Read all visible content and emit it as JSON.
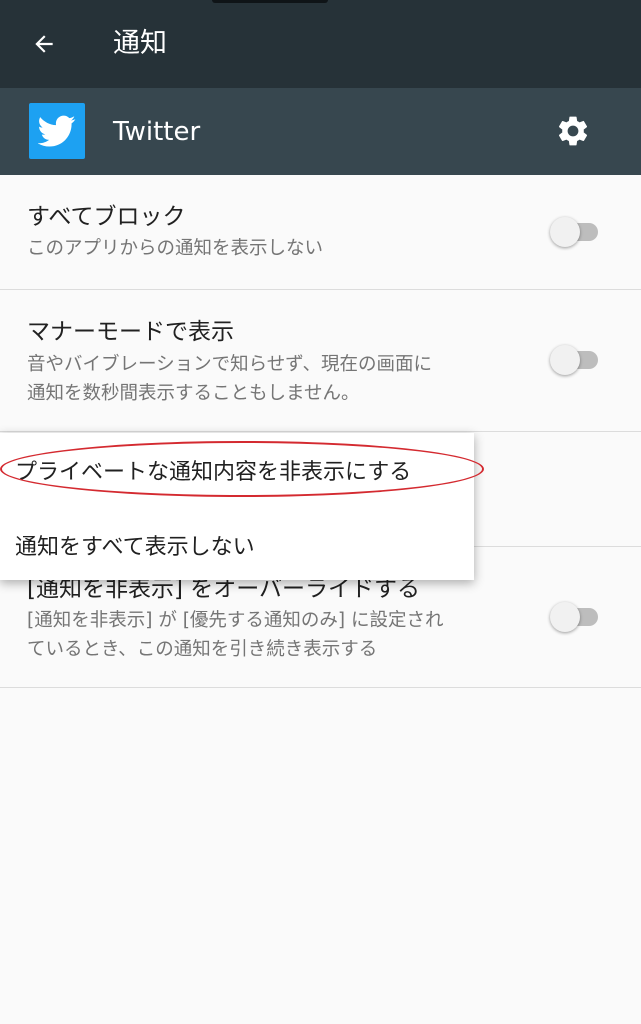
{
  "header": {
    "title": "通知",
    "back_icon": "arrow-left-icon"
  },
  "app": {
    "name": "Twitter",
    "icon": "twitter-bird-icon",
    "icon_color": "#1da1f2",
    "settings_icon": "gear-icon"
  },
  "settings": [
    {
      "title": "すべてブロック",
      "subtitle": "このアプリからの通知を表示しない",
      "enabled": false
    },
    {
      "title": "マナーモードで表示",
      "subtitle": "音やバイブレーションで知らせず、現在の画面に\n通知を数秒間表示することもしません。",
      "enabled": false
    },
    {
      "title": "[通知を非表示] をオーバーライドする",
      "subtitle": "[通知を非表示] が [優先する通知のみ] に設定され\nているとき、この通知を引き続き表示する",
      "enabled": false
    }
  ],
  "lockscreen_menu": {
    "options": [
      "プライベートな通知内容を非表示にする",
      "通知をすべて表示しない"
    ],
    "highlighted_index": 0,
    "highlight_color": "#d42a30"
  },
  "colors": {
    "toolbar": "#263238",
    "app_header": "#37474f",
    "background": "#fafafa"
  }
}
